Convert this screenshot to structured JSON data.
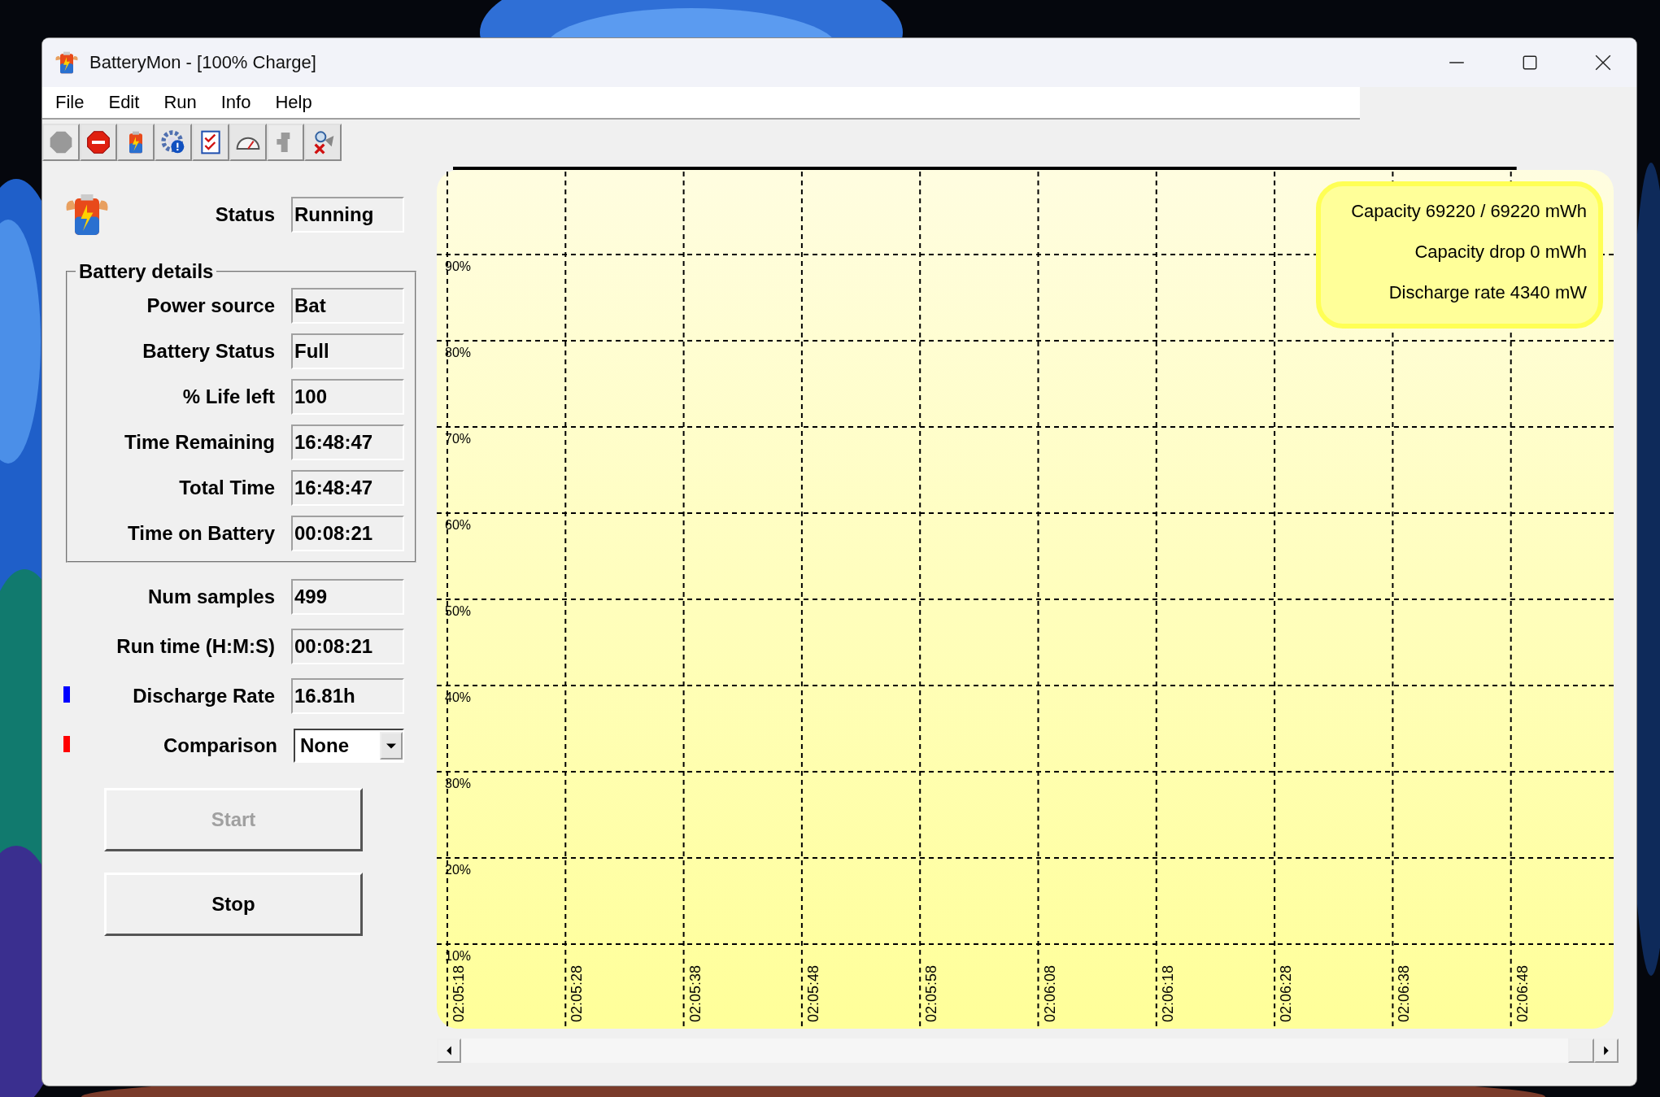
{
  "window": {
    "title": "BatteryMon - [100% Charge]"
  },
  "menu": [
    "File",
    "Edit",
    "Run",
    "Info",
    "Help"
  ],
  "toolbar": [
    {
      "kind": "record",
      "disabled": true
    },
    {
      "kind": "stop",
      "disabled": false
    },
    {
      "kind": "battery",
      "disabled": false
    },
    {
      "kind": "settings",
      "disabled": false
    },
    {
      "kind": "checklist",
      "disabled": false
    },
    {
      "kind": "gauge",
      "disabled": false
    },
    {
      "kind": "plug",
      "disabled": true
    },
    {
      "kind": "inspect",
      "disabled": false
    }
  ],
  "status": {
    "label": "Status",
    "value": "Running"
  },
  "battery_details": {
    "title": "Battery details",
    "fields": [
      {
        "label": "Power source",
        "value": "Bat"
      },
      {
        "label": "Battery Status",
        "value": "Full"
      },
      {
        "label": "% Life left",
        "value": "100"
      },
      {
        "label": "Time Remaining",
        "value": "16:48:47"
      },
      {
        "label": "Total Time",
        "value": "16:48:47"
      },
      {
        "label": "Time on Battery",
        "value": "00:08:21"
      }
    ]
  },
  "stats": [
    {
      "label": "Num samples",
      "value": "499"
    },
    {
      "label": "Run time (H:M:S)",
      "value": "00:08:21"
    },
    {
      "label": "Discharge Rate",
      "value": "16.81h",
      "color": "#0000ff"
    }
  ],
  "comparison": {
    "label": "Comparison",
    "value": "None",
    "color": "#ff0000"
  },
  "buttons": [
    {
      "label": "Start",
      "disabled": true
    },
    {
      "label": "Stop",
      "disabled": false
    }
  ],
  "chart": {
    "legend": [
      "Capacity 69220 / 69220 mWh",
      "Capacity drop 0 mWh",
      "Discharge rate 4340 mW"
    ],
    "chart_data": {
      "type": "line",
      "categories": [
        "02:05:18",
        "02:05:28",
        "02:05:38",
        "02:05:48",
        "02:05:58",
        "02:06:08",
        "02:06:18",
        "02:06:28",
        "02:06:38",
        "02:06:48"
      ],
      "values": [
        100,
        100,
        100,
        100,
        100,
        100,
        100,
        100,
        100,
        100
      ],
      "ylim": [
        0,
        100
      ],
      "grid": true,
      "yticks": [
        {
          "value": 90,
          "label": "90%"
        },
        {
          "value": 80,
          "label": "80%"
        },
        {
          "value": 70,
          "label": "70%"
        },
        {
          "value": 60,
          "label": "60%"
        },
        {
          "value": 50,
          "label": "50%"
        },
        {
          "value": 40,
          "label": "40%"
        },
        {
          "value": 30,
          "label": "30%"
        },
        {
          "value": 20,
          "label": "20%"
        },
        {
          "value": 10,
          "label": "10%"
        }
      ]
    }
  }
}
